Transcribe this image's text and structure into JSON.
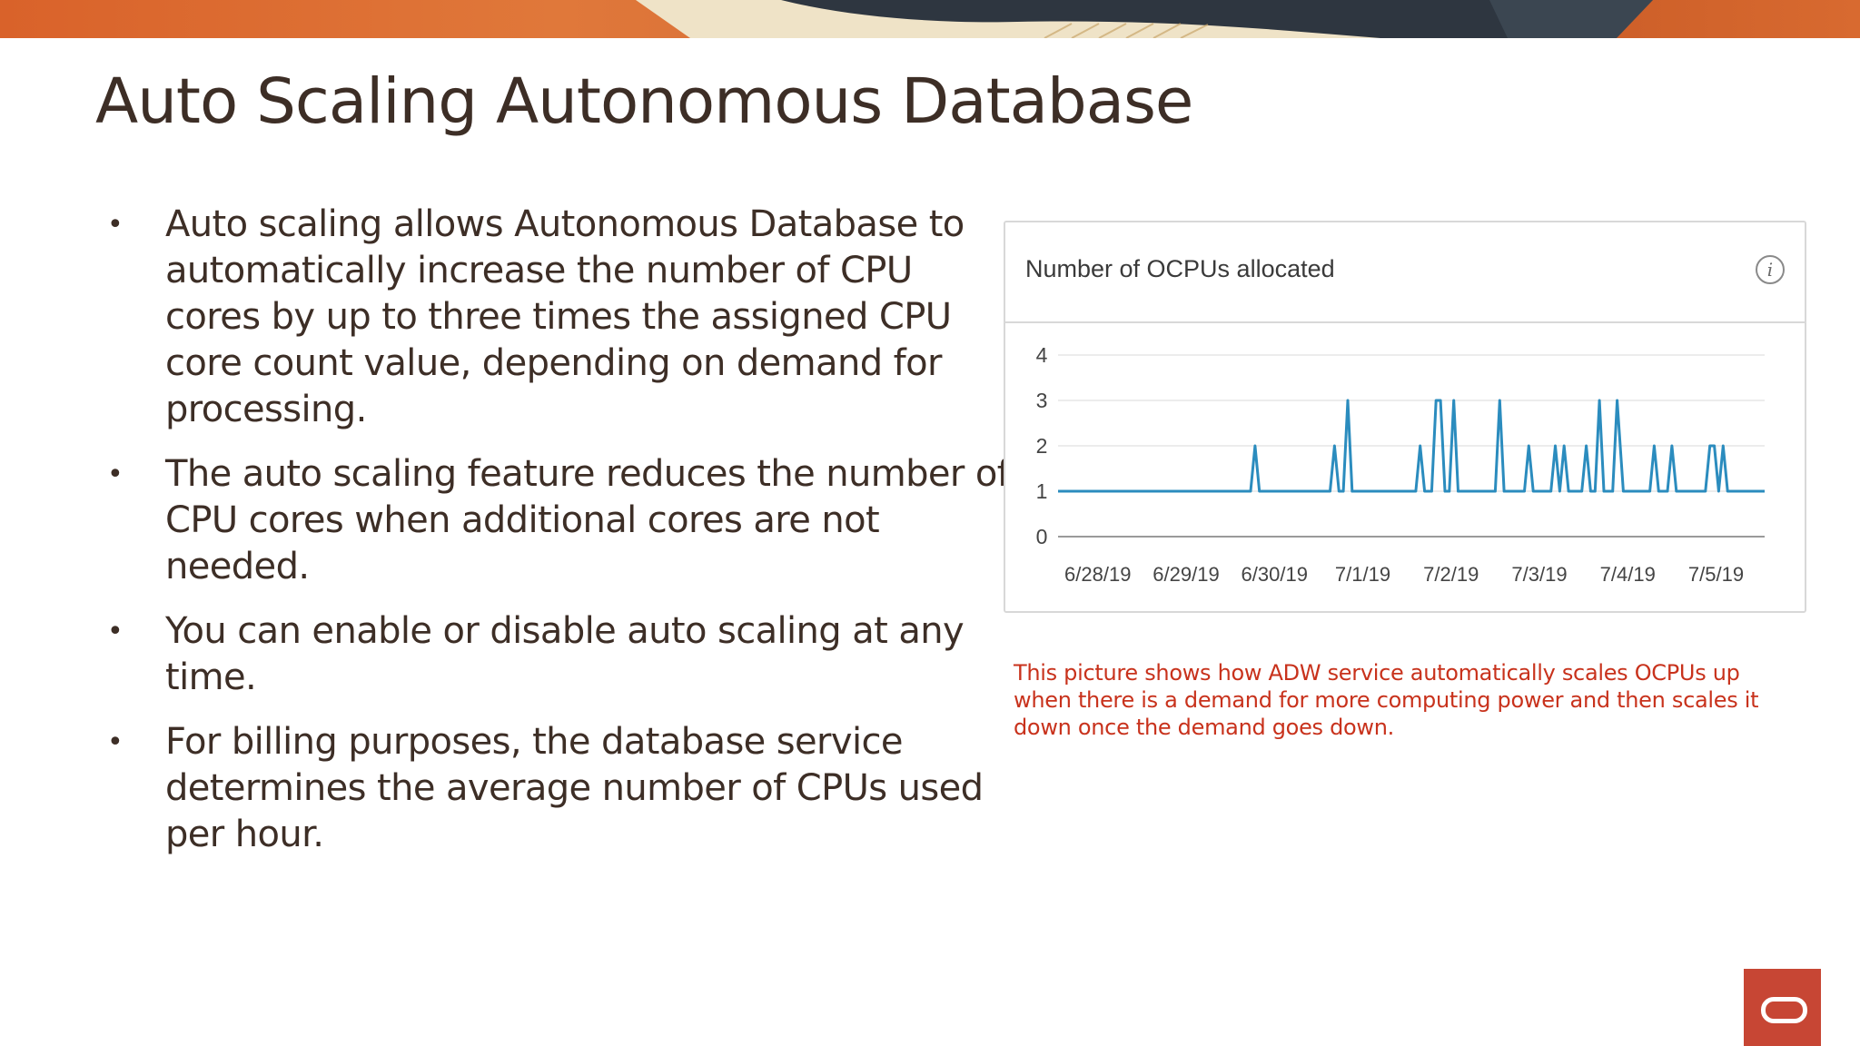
{
  "slide": {
    "title": "Auto Scaling Autonomous Database",
    "bullets": [
      "Auto scaling allows Autonomous Database to automatically increase the number of CPU cores by up to three times the assigned CPU core count value, depending on demand for processing.",
      "The auto scaling feature reduces the number of CPU cores when additional cores are not needed.",
      "You can enable or disable auto scaling at any time.",
      "For billing purposes, the database service determines the average number of CPUs used per hour."
    ],
    "bullet_symbol": "•",
    "caption": "This picture shows how ADW service automatically scales OCPUs up when there is a demand for more computing power and then scales it down once the demand goes down.",
    "colors": {
      "title": "#3d2e26",
      "caption": "#c8321c",
      "line": "#2b8cbe",
      "logo": "#c74634"
    },
    "icons": {
      "info": "info-icon",
      "logo": "oracle-logo-icon"
    }
  },
  "chart_data": {
    "type": "line",
    "title": "Number of OCPUs allocated",
    "x_tick_labels": [
      "6/28/19",
      "6/29/19",
      "6/30/19",
      "7/1/19",
      "7/2/19",
      "7/3/19",
      "7/4/19",
      "7/5/19"
    ],
    "y_ticks": [
      0,
      1,
      2,
      3,
      4
    ],
    "ylim": [
      0,
      4
    ],
    "xlim": [
      0,
      8
    ],
    "grid": true,
    "series": [
      {
        "x": [
          0,
          2.18,
          2.23,
          2.28,
          3.08,
          3.13,
          3.18,
          3.23,
          3.28,
          3.33,
          3.38,
          4.05,
          4.1,
          4.15,
          4.23,
          4.28,
          4.33,
          4.38,
          4.43,
          4.48,
          4.53,
          4.58,
          4.63,
          4.95,
          5.0,
          5.05,
          5.28,
          5.33,
          5.38,
          5.58,
          5.63,
          5.68,
          5.73,
          5.78,
          5.83,
          5.93,
          5.98,
          6.03,
          6.08,
          6.13,
          6.18,
          6.23,
          6.28,
          6.33,
          6.4,
          6.45,
          6.5,
          6.7,
          6.75,
          6.8,
          6.9,
          6.95,
          7.0,
          7.33,
          7.38,
          7.43,
          7.48,
          7.53,
          7.58,
          8
        ],
        "y": [
          1,
          1,
          2,
          1,
          1,
          2,
          1,
          1,
          3,
          1,
          1,
          1,
          2,
          1,
          1,
          3,
          3,
          1,
          1,
          3,
          1,
          1,
          1,
          1,
          3,
          1,
          1,
          2,
          1,
          1,
          2,
          1,
          2,
          1,
          1,
          1,
          2,
          1,
          1,
          3,
          1,
          1,
          1,
          3,
          1,
          1,
          1,
          1,
          2,
          1,
          1,
          2,
          1,
          1,
          2,
          2,
          1,
          2,
          1,
          1
        ]
      }
    ]
  }
}
